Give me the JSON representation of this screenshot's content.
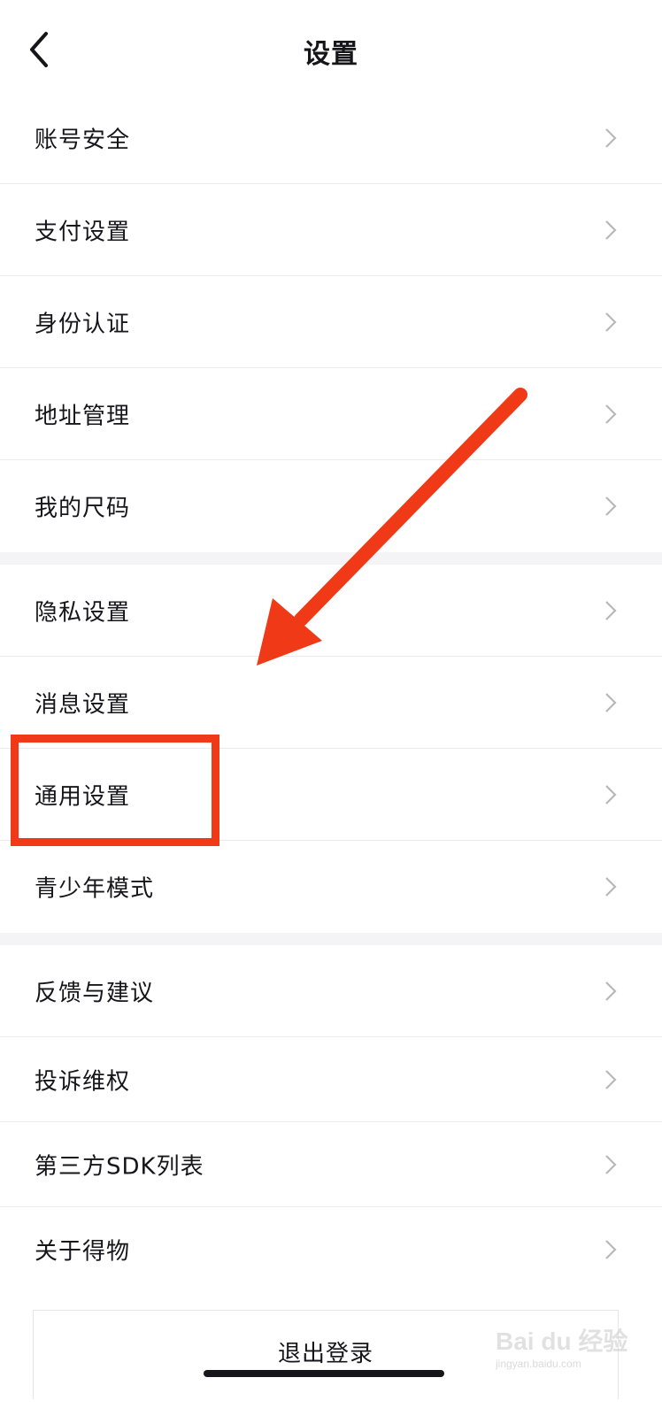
{
  "header": {
    "title": "设置"
  },
  "groups": [
    {
      "items": [
        {
          "label": "账号安全"
        },
        {
          "label": "支付设置"
        },
        {
          "label": "身份认证"
        },
        {
          "label": "地址管理"
        },
        {
          "label": "我的尺码"
        }
      ]
    },
    {
      "items": [
        {
          "label": "隐私设置"
        },
        {
          "label": "消息设置"
        },
        {
          "label": "通用设置"
        },
        {
          "label": "青少年模式"
        }
      ]
    },
    {
      "items": [
        {
          "label": "反馈与建议"
        },
        {
          "label": "投诉维权"
        },
        {
          "label": "第三方SDK列表"
        },
        {
          "label": "关于得物"
        }
      ]
    }
  ],
  "logout": {
    "label": "退出登录"
  },
  "annotation": {
    "color": "#f03a17",
    "highlighted_item": "通用设置"
  },
  "watermark": {
    "main": "Bai du 经验",
    "sub": "jingyan.baidu.com"
  }
}
